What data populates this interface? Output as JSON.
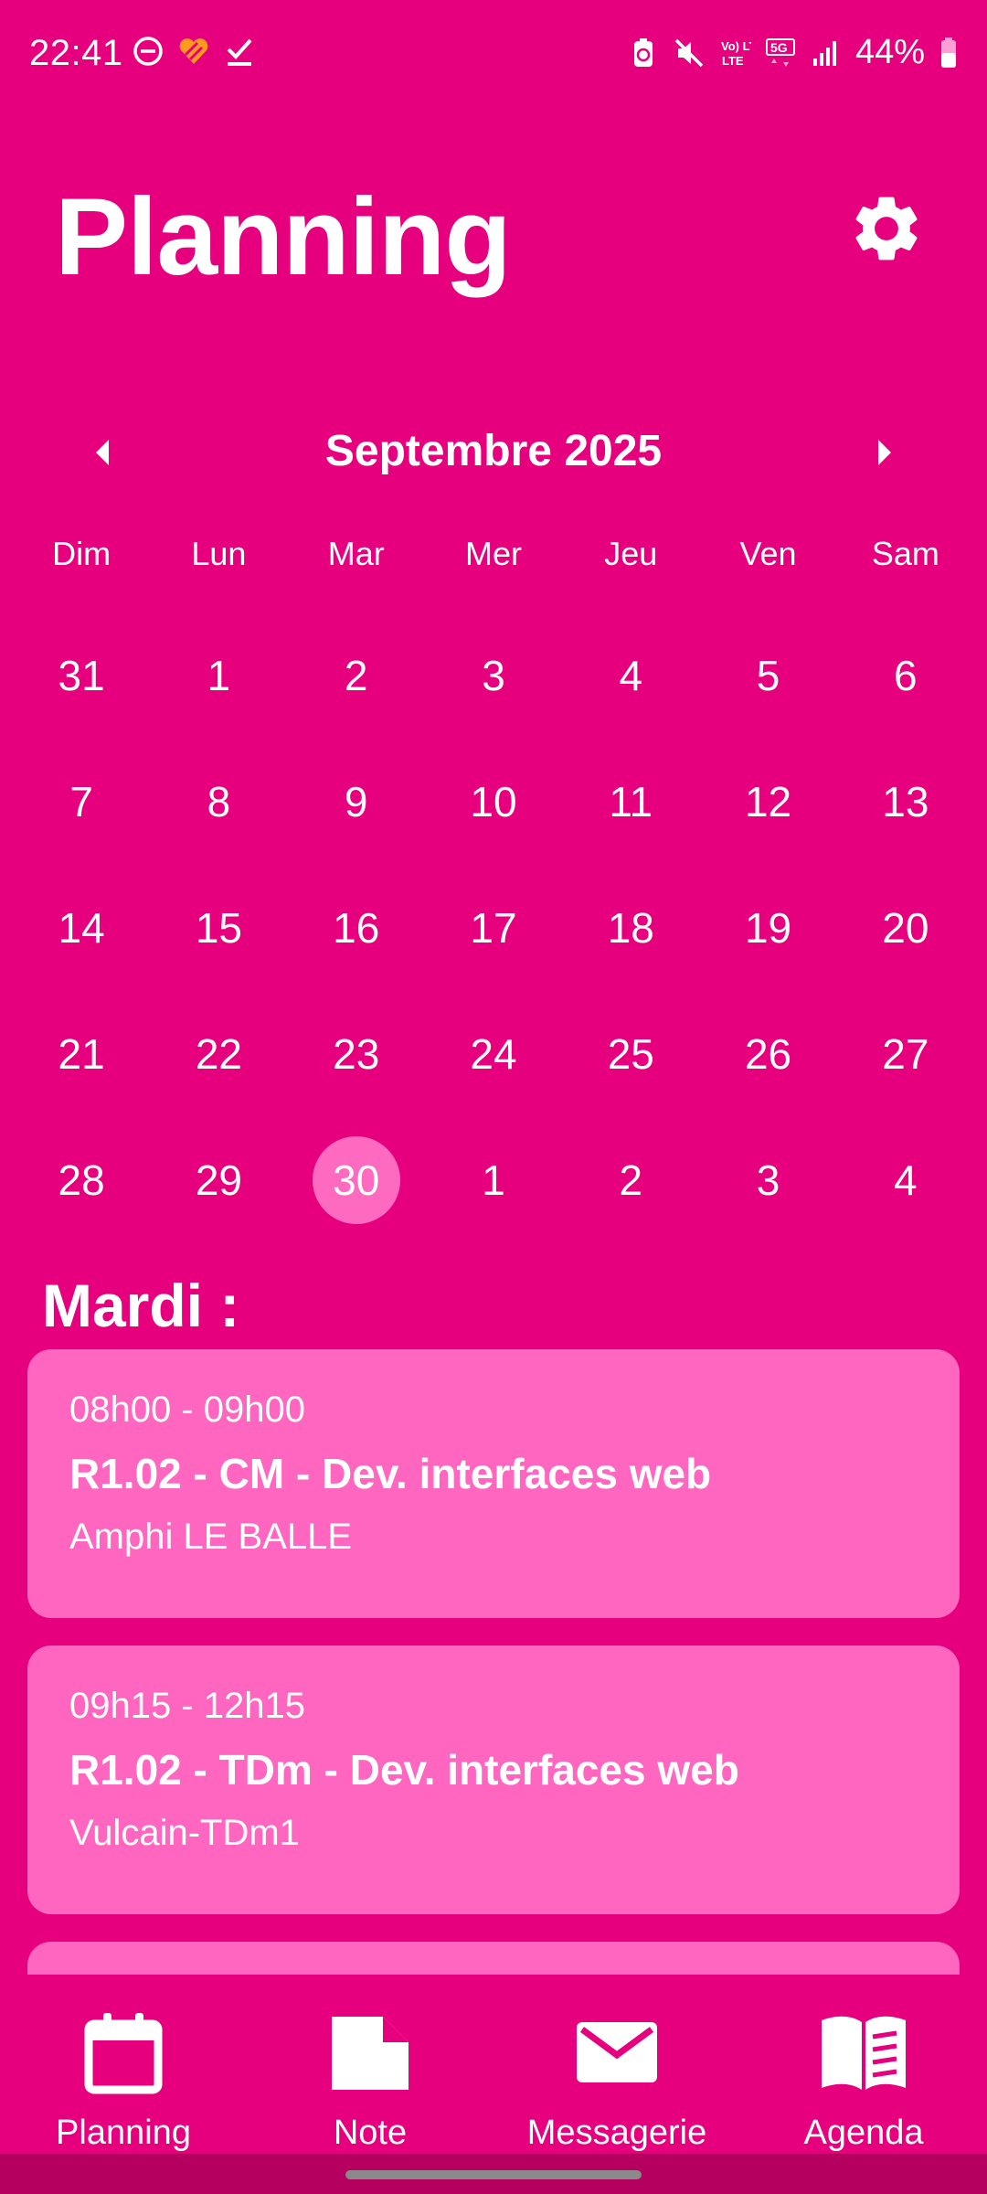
{
  "status_bar": {
    "time": "22:41",
    "battery": "44%",
    "left_icons": [
      "do-not-disturb-icon",
      "app-heart-icon",
      "check-icon"
    ],
    "right_icons": [
      "battery-saver-icon",
      "mute-icon",
      "volte-icon",
      "5g-icon",
      "signal-icon",
      "battery-icon"
    ],
    "volte_label": "Vo) LTE",
    "network_label": "5G"
  },
  "header": {
    "title": "Planning",
    "settings_icon": "gear-icon"
  },
  "calendar": {
    "month_label": "Septembre 2025",
    "weekdays": [
      "Dim",
      "Lun",
      "Mar",
      "Mer",
      "Jeu",
      "Ven",
      "Sam"
    ],
    "weeks": [
      [
        "31",
        "1",
        "2",
        "3",
        "4",
        "5",
        "6"
      ],
      [
        "7",
        "8",
        "9",
        "10",
        "11",
        "12",
        "13"
      ],
      [
        "14",
        "15",
        "16",
        "17",
        "18",
        "19",
        "20"
      ],
      [
        "21",
        "22",
        "23",
        "24",
        "25",
        "26",
        "27"
      ],
      [
        "28",
        "29",
        "30",
        "1",
        "2",
        "3",
        "4"
      ]
    ],
    "selected_day": "30"
  },
  "schedule": {
    "day_label": "Mardi :",
    "events": [
      {
        "time": "08h00 - 09h00",
        "title": "R1.02 - CM - Dev. interfaces web",
        "room": "Amphi LE BALLE"
      },
      {
        "time": "09h15 - 12h15",
        "title": "R1.02 - TDm - Dev. interfaces web",
        "room": "Vulcain-TDm1"
      },
      {
        "time": "",
        "title": "",
        "room": ""
      }
    ]
  },
  "bottom_nav": {
    "items": [
      {
        "label": "Planning",
        "icon": "calendar-icon"
      },
      {
        "label": "Note",
        "icon": "note-icon"
      },
      {
        "label": "Messagerie",
        "icon": "mail-icon"
      },
      {
        "label": "Agenda",
        "icon": "book-icon"
      }
    ]
  },
  "colors": {
    "background": "#E6007E",
    "card": "#FF66C0",
    "selected_day": "#FF6AC1",
    "text": "#FFFFFF"
  }
}
